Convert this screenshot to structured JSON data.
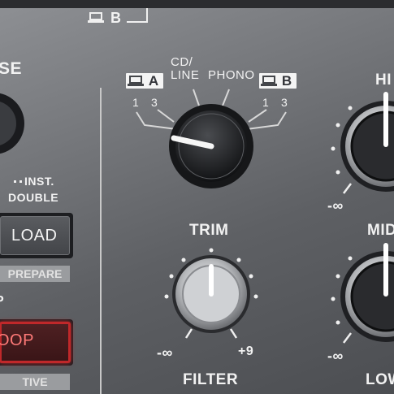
{
  "top": {
    "deck_b_label": "B"
  },
  "left": {
    "partial_label": "SE",
    "inst_double_top": "INST.",
    "inst_double_bottom": "DOUBLE",
    "load_button": "LOAD",
    "prepare_label": "PREPARE",
    "partial_p": "P",
    "loop_button": "OOP",
    "active_label": "TIVE"
  },
  "input_selector": {
    "deck_a_letter": "A",
    "deck_b_letter": "B",
    "cd_line_top": "CD/",
    "cd_line_bottom": "LINE",
    "phono": "PHONO",
    "a_num1": "1",
    "a_num2": "3",
    "b_num1": "1",
    "b_num2": "3"
  },
  "trim": {
    "label": "TRIM",
    "min": "-∞",
    "max": "+9"
  },
  "filter": {
    "label": "FILTER"
  },
  "eq": {
    "hi_label": "HI",
    "mid_label": "MID",
    "low_label": "LOW",
    "hi_min": "-∞",
    "mid_min": "-∞"
  },
  "colors": {
    "loop_red": "#c0282a",
    "panel": "#6b6d70"
  }
}
